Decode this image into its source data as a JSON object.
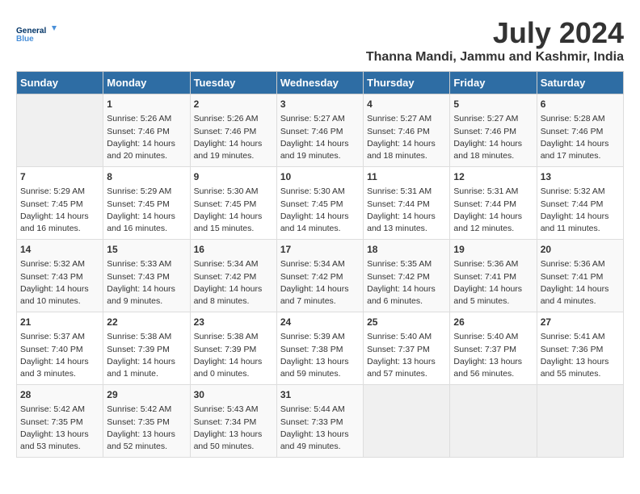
{
  "logo": {
    "line1": "General",
    "line2": "Blue"
  },
  "header": {
    "month": "July 2024",
    "location": "Thanna Mandi, Jammu and Kashmir, India"
  },
  "weekdays": [
    "Sunday",
    "Monday",
    "Tuesday",
    "Wednesday",
    "Thursday",
    "Friday",
    "Saturday"
  ],
  "weeks": [
    [
      {
        "day": "",
        "info": ""
      },
      {
        "day": "1",
        "info": "Sunrise: 5:26 AM\nSunset: 7:46 PM\nDaylight: 14 hours\nand 20 minutes."
      },
      {
        "day": "2",
        "info": "Sunrise: 5:26 AM\nSunset: 7:46 PM\nDaylight: 14 hours\nand 19 minutes."
      },
      {
        "day": "3",
        "info": "Sunrise: 5:27 AM\nSunset: 7:46 PM\nDaylight: 14 hours\nand 19 minutes."
      },
      {
        "day": "4",
        "info": "Sunrise: 5:27 AM\nSunset: 7:46 PM\nDaylight: 14 hours\nand 18 minutes."
      },
      {
        "day": "5",
        "info": "Sunrise: 5:27 AM\nSunset: 7:46 PM\nDaylight: 14 hours\nand 18 minutes."
      },
      {
        "day": "6",
        "info": "Sunrise: 5:28 AM\nSunset: 7:46 PM\nDaylight: 14 hours\nand 17 minutes."
      }
    ],
    [
      {
        "day": "7",
        "info": "Sunrise: 5:29 AM\nSunset: 7:45 PM\nDaylight: 14 hours\nand 16 minutes."
      },
      {
        "day": "8",
        "info": "Sunrise: 5:29 AM\nSunset: 7:45 PM\nDaylight: 14 hours\nand 16 minutes."
      },
      {
        "day": "9",
        "info": "Sunrise: 5:30 AM\nSunset: 7:45 PM\nDaylight: 14 hours\nand 15 minutes."
      },
      {
        "day": "10",
        "info": "Sunrise: 5:30 AM\nSunset: 7:45 PM\nDaylight: 14 hours\nand 14 minutes."
      },
      {
        "day": "11",
        "info": "Sunrise: 5:31 AM\nSunset: 7:44 PM\nDaylight: 14 hours\nand 13 minutes."
      },
      {
        "day": "12",
        "info": "Sunrise: 5:31 AM\nSunset: 7:44 PM\nDaylight: 14 hours\nand 12 minutes."
      },
      {
        "day": "13",
        "info": "Sunrise: 5:32 AM\nSunset: 7:44 PM\nDaylight: 14 hours\nand 11 minutes."
      }
    ],
    [
      {
        "day": "14",
        "info": "Sunrise: 5:32 AM\nSunset: 7:43 PM\nDaylight: 14 hours\nand 10 minutes."
      },
      {
        "day": "15",
        "info": "Sunrise: 5:33 AM\nSunset: 7:43 PM\nDaylight: 14 hours\nand 9 minutes."
      },
      {
        "day": "16",
        "info": "Sunrise: 5:34 AM\nSunset: 7:42 PM\nDaylight: 14 hours\nand 8 minutes."
      },
      {
        "day": "17",
        "info": "Sunrise: 5:34 AM\nSunset: 7:42 PM\nDaylight: 14 hours\nand 7 minutes."
      },
      {
        "day": "18",
        "info": "Sunrise: 5:35 AM\nSunset: 7:42 PM\nDaylight: 14 hours\nand 6 minutes."
      },
      {
        "day": "19",
        "info": "Sunrise: 5:36 AM\nSunset: 7:41 PM\nDaylight: 14 hours\nand 5 minutes."
      },
      {
        "day": "20",
        "info": "Sunrise: 5:36 AM\nSunset: 7:41 PM\nDaylight: 14 hours\nand 4 minutes."
      }
    ],
    [
      {
        "day": "21",
        "info": "Sunrise: 5:37 AM\nSunset: 7:40 PM\nDaylight: 14 hours\nand 3 minutes."
      },
      {
        "day": "22",
        "info": "Sunrise: 5:38 AM\nSunset: 7:39 PM\nDaylight: 14 hours\nand 1 minute."
      },
      {
        "day": "23",
        "info": "Sunrise: 5:38 AM\nSunset: 7:39 PM\nDaylight: 14 hours\nand 0 minutes."
      },
      {
        "day": "24",
        "info": "Sunrise: 5:39 AM\nSunset: 7:38 PM\nDaylight: 13 hours\nand 59 minutes."
      },
      {
        "day": "25",
        "info": "Sunrise: 5:40 AM\nSunset: 7:37 PM\nDaylight: 13 hours\nand 57 minutes."
      },
      {
        "day": "26",
        "info": "Sunrise: 5:40 AM\nSunset: 7:37 PM\nDaylight: 13 hours\nand 56 minutes."
      },
      {
        "day": "27",
        "info": "Sunrise: 5:41 AM\nSunset: 7:36 PM\nDaylight: 13 hours\nand 55 minutes."
      }
    ],
    [
      {
        "day": "28",
        "info": "Sunrise: 5:42 AM\nSunset: 7:35 PM\nDaylight: 13 hours\nand 53 minutes."
      },
      {
        "day": "29",
        "info": "Sunrise: 5:42 AM\nSunset: 7:35 PM\nDaylight: 13 hours\nand 52 minutes."
      },
      {
        "day": "30",
        "info": "Sunrise: 5:43 AM\nSunset: 7:34 PM\nDaylight: 13 hours\nand 50 minutes."
      },
      {
        "day": "31",
        "info": "Sunrise: 5:44 AM\nSunset: 7:33 PM\nDaylight: 13 hours\nand 49 minutes."
      },
      {
        "day": "",
        "info": ""
      },
      {
        "day": "",
        "info": ""
      },
      {
        "day": "",
        "info": ""
      }
    ]
  ]
}
